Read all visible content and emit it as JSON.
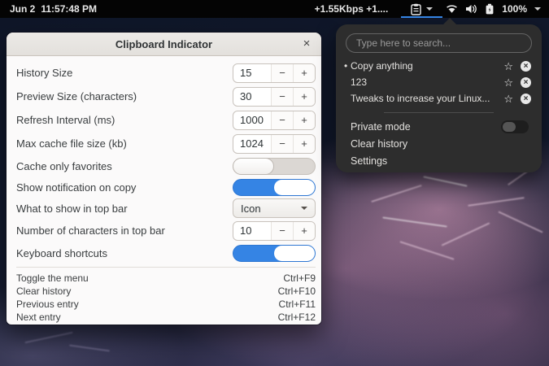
{
  "topbar": {
    "clock_date": "Jun 2",
    "clock_time": "11:57:48 PM",
    "network_speed": "+1.55Kbps +1....",
    "battery_percent": "100%"
  },
  "panel": {
    "search_placeholder": "Type here to search...",
    "bullet": "•",
    "star_glyph": "☆",
    "close_glyph": "×",
    "items": [
      {
        "label": "Copy anything",
        "selected": true
      },
      {
        "label": "123",
        "selected": false
      },
      {
        "label": "Tweaks to increase your Linux...",
        "selected": false
      }
    ],
    "private_mode_label": "Private mode",
    "private_mode_state": "off",
    "clear_history_label": "Clear history",
    "settings_label": "Settings"
  },
  "window": {
    "title": "Clipboard Indicator",
    "close_label": "×",
    "spin_minus": "−",
    "spin_plus": "+",
    "rows": [
      {
        "label": "History Size",
        "type": "spin",
        "value": "15"
      },
      {
        "label": "Preview Size (characters)",
        "type": "spin",
        "value": "30"
      },
      {
        "label": "Refresh Interval (ms)",
        "type": "spin",
        "value": "1000"
      },
      {
        "label": "Max cache file size (kb)",
        "type": "spin",
        "value": "1024"
      },
      {
        "label": "Cache only favorites",
        "type": "toggle",
        "value": "off"
      },
      {
        "label": "Show notification on copy",
        "type": "toggle",
        "value": "on"
      },
      {
        "label": "What to show in top bar",
        "type": "select",
        "value": "Icon"
      },
      {
        "label": "Number of characters in top bar",
        "type": "spin",
        "value": "10"
      },
      {
        "label": "Keyboard shortcuts",
        "type": "toggle",
        "value": "on"
      }
    ],
    "shortcuts": [
      {
        "label": "Toggle the menu",
        "value": "Ctrl+F9"
      },
      {
        "label": "Clear history",
        "value": "Ctrl+F10"
      },
      {
        "label": "Previous entry",
        "value": "Ctrl+F11"
      },
      {
        "label": "Next entry",
        "value": "Ctrl+F12"
      }
    ]
  },
  "colors": {
    "accent_blue": "#3584e4",
    "panel_bg": "#2d2d2d",
    "topbar_bg": "#040404",
    "window_bg": "#fbfafa"
  }
}
